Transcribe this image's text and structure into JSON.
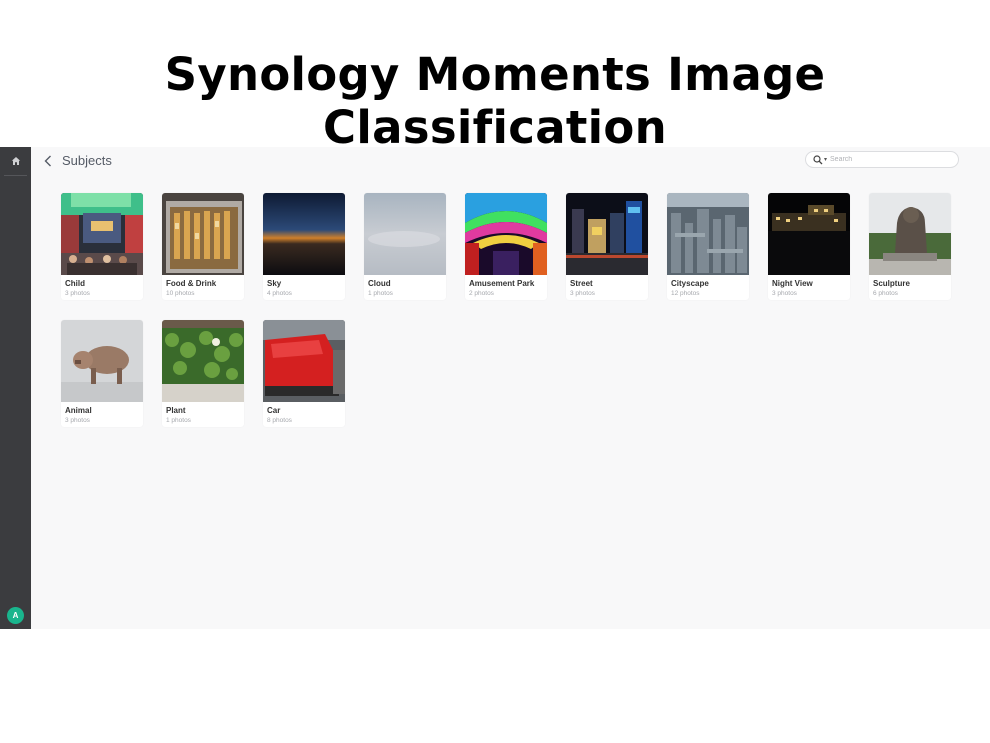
{
  "headline": "Synology Moments Image Classification",
  "header": {
    "title": "Subjects",
    "search_placeholder": "Search"
  },
  "sidebar": {
    "home_icon": "home-icon",
    "avatar_letter": "A",
    "avatar_color": "#19b58d"
  },
  "subjects": [
    {
      "name": "Child",
      "count": "3 photos"
    },
    {
      "name": "Food & Drink",
      "count": "10 photos"
    },
    {
      "name": "Sky",
      "count": "4 photos"
    },
    {
      "name": "Cloud",
      "count": "1 photos"
    },
    {
      "name": "Amusement Park",
      "count": "2 photos"
    },
    {
      "name": "Street",
      "count": "3 photos"
    },
    {
      "name": "Cityscape",
      "count": "12 photos"
    },
    {
      "name": "Night View",
      "count": "3 photos"
    },
    {
      "name": "Sculpture",
      "count": "6 photos"
    },
    {
      "name": "Animal",
      "count": "3 photos"
    },
    {
      "name": "Plant",
      "count": "1 photos"
    },
    {
      "name": "Car",
      "count": "8 photos"
    }
  ]
}
